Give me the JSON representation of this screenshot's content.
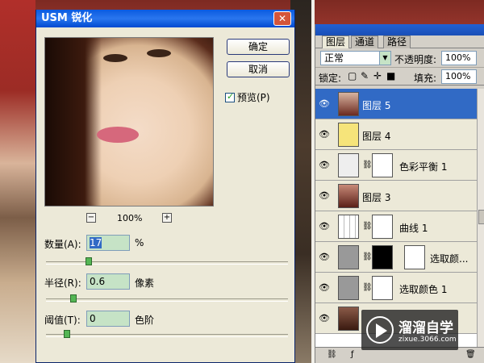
{
  "dialog": {
    "title": "USM 锐化",
    "close": "✕",
    "ok_label": "确定",
    "cancel_label": "取消",
    "preview_label": "预览(P)",
    "zoom_minus": "−",
    "zoom_plus": "+",
    "zoom": "100%",
    "amount": {
      "label": "数量(A):",
      "value": "17",
      "unit": "%",
      "slider_fraction": 0.1
    },
    "radius": {
      "label": "半径(R):",
      "value": "0.6",
      "unit": "像素",
      "slider_fraction": 0.03
    },
    "threshold": {
      "label": "阈值(T):",
      "value": "0",
      "unit": "色阶",
      "slider_fraction": 0.0
    }
  },
  "layers_panel": {
    "tabs": [
      "图层",
      "通道",
      "路径"
    ],
    "blend_mode": "正常",
    "opacity_label": "不透明度:",
    "opacity_value": "100%",
    "lock_label": "锁定:",
    "fill_label": "填充:",
    "fill_value": "100%",
    "layers": [
      {
        "name": "图层 5",
        "active": true
      },
      {
        "name": "图层 4",
        "active": false
      },
      {
        "name": "色彩平衡 1",
        "active": false
      },
      {
        "name": "图层 3",
        "active": false
      },
      {
        "name": "曲线 1",
        "active": false
      },
      {
        "name": "选取颜...",
        "active": false
      },
      {
        "name": "选取颜色 1",
        "active": false
      },
      {
        "name": "",
        "active": false
      }
    ]
  },
  "watermark": {
    "title": "溜溜自学",
    "url": "zixue.3066.com"
  },
  "colors": {
    "accent": "#316ac5",
    "title_blue": "#0a5be0",
    "dialog_bg": "#ece9d8",
    "field_bg": "#c6e3c6"
  }
}
